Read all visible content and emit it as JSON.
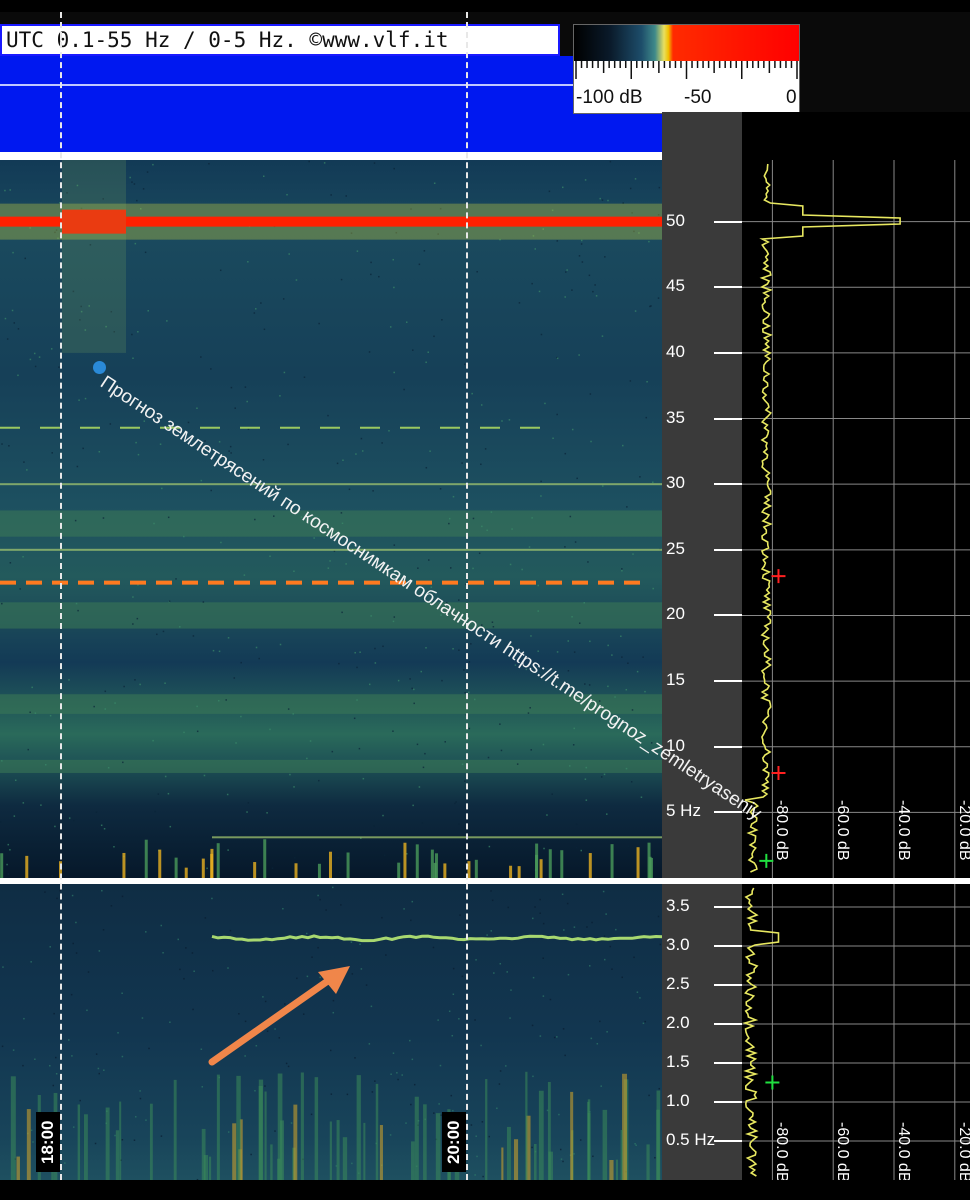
{
  "header": {
    "title": "UTC 0.1-55 Hz / 0-5 Hz. ©www.vlf.it"
  },
  "colorbar": {
    "labels": [
      "-100 dB",
      "-50",
      "0"
    ]
  },
  "watermark": {
    "text": "Прогноз землетрясений по космоснимкам облачности  https://t.me/prognoz_zemletryaseniy"
  },
  "time_labels": [
    "18:00",
    "20:00"
  ],
  "colors": {
    "spectral_line": "#ff2000",
    "trace": "#e8e860",
    "arrow": "#f0864a",
    "marker_red": "#ff2020",
    "marker_green": "#20e040"
  },
  "chart_data": [
    {
      "type": "heatmap",
      "panel": "upper spectrogram",
      "title": "UTC 0.1-55 Hz / 0-5 Hz. ©www.vlf.it",
      "xlabel": "",
      "ylabel": "",
      "y_unit_label": "Hz",
      "ylim": [
        0,
        55
      ],
      "y_ticks": [
        5,
        10,
        15,
        20,
        25,
        30,
        35,
        40,
        45,
        50
      ],
      "y_tick_labels": [
        "5 Hz",
        "10",
        "15",
        "20",
        "25",
        "30",
        "35",
        "40",
        "45",
        "50"
      ],
      "x_ticks": [
        "18:00",
        "20:00"
      ],
      "color_scale_db": [
        -100,
        0
      ],
      "color_scale_labels": [
        "-100 dB",
        "-50",
        "0"
      ],
      "strong_lines_hz": [
        50,
        22.5
      ],
      "weak_lines_hz": [
        34.3,
        30,
        25,
        3.1
      ],
      "bright_bands_hz": [
        [
          8,
          9
        ],
        [
          12.5,
          14
        ],
        [
          19,
          21
        ],
        [
          26,
          28
        ]
      ]
    },
    {
      "type": "heatmap",
      "panel": "lower spectrogram",
      "ylabel": "",
      "ylim": [
        0,
        4
      ],
      "y_ticks": [
        0.5,
        1.0,
        1.5,
        2.0,
        2.5,
        3.0,
        3.5
      ],
      "y_tick_labels": [
        "0.5 Hz",
        "1.0",
        "1.5",
        "2.0",
        "2.5",
        "3.0",
        "3.5"
      ],
      "x_ticks": [
        "18:00",
        "20:00"
      ],
      "highlighted_line_hz": 3.1,
      "highlighted_line_start": "~18:40"
    },
    {
      "type": "line",
      "panel": "upper spectrum",
      "x_ticks_db": [
        -80,
        -60,
        -40,
        -20
      ],
      "x_tick_labels": [
        "-80.0 dB",
        "-60.0 dB",
        "-40.0 dB",
        "-20.0 dB"
      ],
      "xlim": [
        -90,
        -15
      ],
      "ylim": [
        0,
        55
      ],
      "peak_hz": 50,
      "peak_db": -38,
      "markers": [
        {
          "color": "red",
          "hz": 23,
          "db": -78
        },
        {
          "color": "red",
          "hz": 8,
          "db": -78
        },
        {
          "color": "green",
          "hz": 1.3,
          "db": -82
        }
      ]
    },
    {
      "type": "line",
      "panel": "lower spectrum",
      "x_ticks_db": [
        -80,
        -60,
        -40,
        -20
      ],
      "x_tick_labels": [
        "-80.0 dB",
        "-60.0 dB",
        "-40.0 dB",
        "-20.0 dB"
      ],
      "ylim": [
        0,
        4
      ],
      "peak_hz": 3.1,
      "markers": [
        {
          "color": "green",
          "hz": 1.25,
          "db": -80
        }
      ]
    }
  ]
}
